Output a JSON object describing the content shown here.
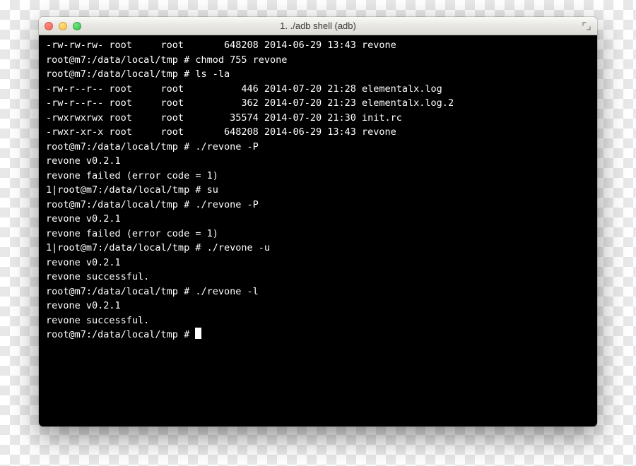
{
  "window": {
    "title": "1. ./adb shell (adb)"
  },
  "lines": [
    "-rw-rw-rw- root     root       648208 2014-06-29 13:43 revone",
    "root@m7:/data/local/tmp # chmod 755 revone",
    "root@m7:/data/local/tmp # ls -la",
    "-rw-r--r-- root     root          446 2014-07-20 21:28 elementalx.log",
    "-rw-r--r-- root     root          362 2014-07-20 21:23 elementalx.log.2",
    "-rwxrwxrwx root     root        35574 2014-07-20 21:30 init.rc",
    "-rwxr-xr-x root     root       648208 2014-06-29 13:43 revone",
    "root@m7:/data/local/tmp # ./revone -P",
    "revone v0.2.1",
    "",
    "revone failed (error code = 1)",
    "1|root@m7:/data/local/tmp # su",
    "root@m7:/data/local/tmp # ./revone -P",
    "revone v0.2.1",
    "",
    "revone failed (error code = 1)",
    "1|root@m7:/data/local/tmp # ./revone -u",
    "revone v0.2.1",
    "",
    "revone successful.",
    "root@m7:/data/local/tmp # ./revone -l",
    "revone v0.2.1",
    "",
    "revone successful.",
    "root@m7:/data/local/tmp # "
  ],
  "cursor_on_last_line": true
}
